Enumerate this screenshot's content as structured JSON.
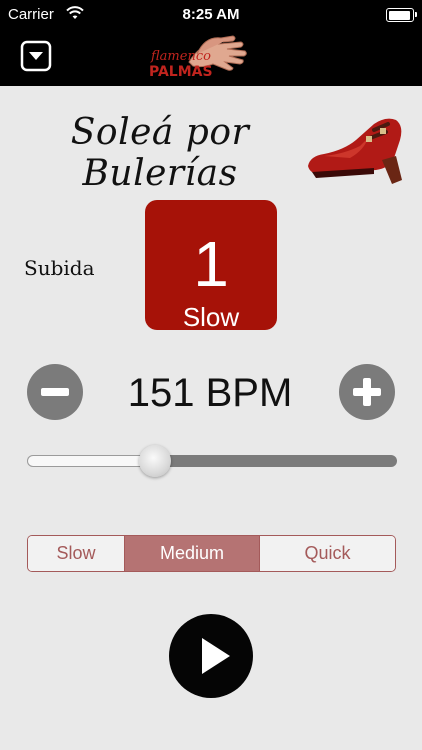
{
  "status_bar": {
    "carrier": "Carrier",
    "time": "8:25 AM",
    "battery_level": 1.0
  },
  "nav": {
    "logo_text_line1": "flamenco",
    "logo_text_line2": "PALMAS"
  },
  "title": "Soleá por Bulerías",
  "section": {
    "label": "Subida",
    "count": "1",
    "speed_label": "Slow"
  },
  "bpm": {
    "display": "151 BPM"
  },
  "slider": {
    "value": 0.33
  },
  "speed_segments": [
    {
      "label": "Slow",
      "selected": false
    },
    {
      "label": "Medium",
      "selected": true
    },
    {
      "label": "Quick",
      "selected": false
    }
  ],
  "colors": {
    "count_box": "#a61208",
    "segment_accent": "#a45a5a",
    "segment_selected": "#b57373"
  },
  "icons": {
    "menu": "dropdown-menu-icon",
    "wifi": "wifi-icon",
    "battery": "battery-icon",
    "minus": "minus-circle-icon",
    "plus": "plus-circle-icon",
    "play": "play-icon",
    "shoe": "flamenco-shoe-image",
    "hands": "clapping-hands-image"
  }
}
